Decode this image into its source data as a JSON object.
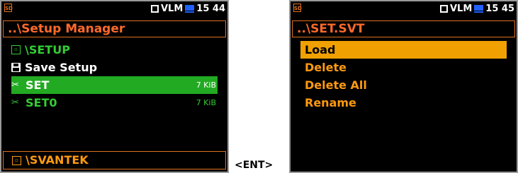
{
  "screen_left": {
    "status": {
      "sd_badge": "SD",
      "mode": "VLM",
      "time": "15 44"
    },
    "title": "..\\Setup Manager",
    "items": [
      {
        "icon": "card-icon",
        "label": "\\SETUP",
        "size": ""
      },
      {
        "icon": "floppy-icon",
        "label": "Save Setup",
        "size": ""
      },
      {
        "icon": "wrench-icon",
        "label": "SET",
        "size": "7 KiB"
      },
      {
        "icon": "wrench-icon",
        "label": "SET0",
        "size": "7 KiB"
      }
    ],
    "bottom": {
      "icon": "card-icon",
      "label": "\\SVANTEK"
    }
  },
  "key_hint": "<ENT>",
  "screen_right": {
    "status": {
      "sd_badge": "SD",
      "mode": "VLM",
      "time": "15 45"
    },
    "title": "..\\SET.SVT",
    "items": [
      "Load",
      "Delete",
      "Delete All",
      "Rename"
    ]
  },
  "colors": {
    "accent_orange": "#ff6a2a",
    "selection_green": "#22aa22",
    "selection_orange": "#f0a000",
    "menu_orange": "#ff9a10",
    "status_blue": "#2060ff"
  }
}
